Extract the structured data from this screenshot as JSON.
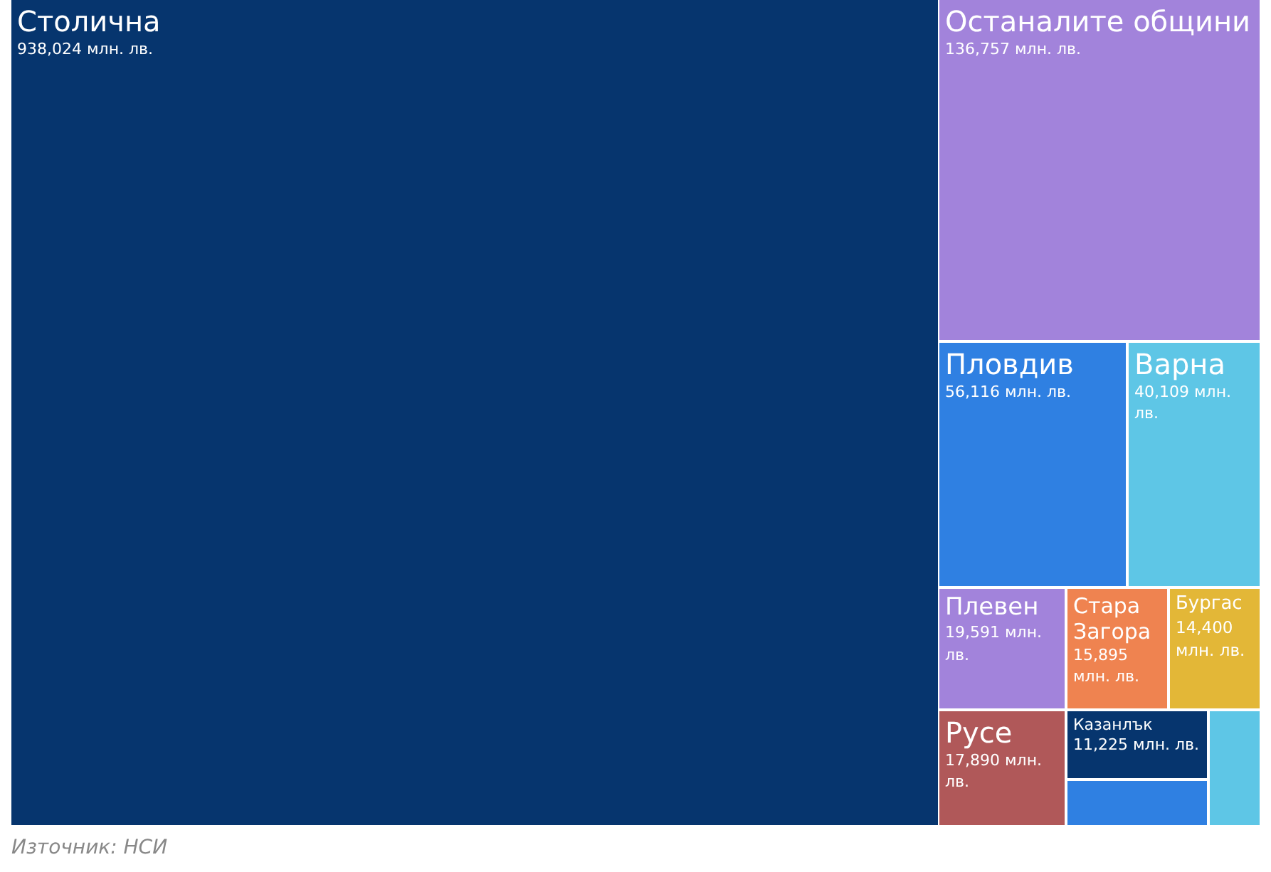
{
  "treemap": {
    "tiles": [
      {
        "name": "Столична",
        "value": "938,024 млн. лв.",
        "color": "#06356e"
      },
      {
        "name": "Останалите общини",
        "value": "136,757 млн. лв.",
        "color": "#a283db"
      },
      {
        "name": "Пловдив",
        "value": "56,116 млн. лв.",
        "color": "#2f80e2"
      },
      {
        "name": "Варна",
        "value": "40,109 млн. лв.",
        "color": "#5ec6e6"
      },
      {
        "name": "Плевен",
        "value": "19,591 млн. лв.",
        "color": "#a283db"
      },
      {
        "name": "Стара Загора",
        "value": "15,895 млн. лв.",
        "color": "#ef8350"
      },
      {
        "name": "Бургас",
        "value": "14,400 млн. лв.",
        "color": "#e3b737"
      },
      {
        "name": "Русе",
        "value": "17,890 млн. лв.",
        "color": "#b05859"
      },
      {
        "name": "Казанлък",
        "value": "11,225 млн. лв.",
        "color": "#06356e"
      },
      {
        "color": "#2f80e2"
      },
      {
        "color": "#5ec6e6"
      }
    ]
  },
  "source": "Източник: НСИ"
}
